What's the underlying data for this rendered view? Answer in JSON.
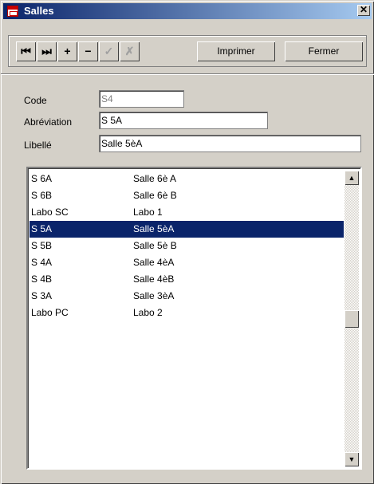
{
  "window": {
    "title": "Salles",
    "close_glyph": "✕"
  },
  "toolbar": {
    "first_glyph": "⏮",
    "last_glyph": "⏭",
    "add_glyph": "+",
    "delete_glyph": "−",
    "validate_glyph": "✓",
    "cancel_glyph": "✗",
    "print_label": "Imprimer",
    "close_label": "Fermer"
  },
  "form": {
    "code_label": "Code",
    "code_value": "S4",
    "abbr_label": "Abréviation",
    "abbr_value": "S 5A",
    "libelle_label": "Libellé",
    "libelle_value": "Salle 5èA"
  },
  "list": {
    "rows": [
      {
        "abbr": "S 6A",
        "name": "Salle 6è A"
      },
      {
        "abbr": "S 6B",
        "name": "Salle 6è B"
      },
      {
        "abbr": "Labo SC",
        "name": "Labo 1"
      },
      {
        "abbr": "S 5A",
        "name": "Salle 5èA"
      },
      {
        "abbr": "S 5B",
        "name": "Salle 5è B"
      },
      {
        "abbr": "S 4A",
        "name": "Salle 4èA"
      },
      {
        "abbr": "S 4B",
        "name": "Salle 4èB"
      },
      {
        "abbr": "S 3A",
        "name": "Salle 3èA"
      },
      {
        "abbr": "Labo PC",
        "name": "Labo 2"
      }
    ],
    "selected_index": 3
  },
  "colors": {
    "selection": "#0a246a",
    "face": "#d4d0c8",
    "title_start": "#0a246a",
    "title_end": "#a6caf0"
  }
}
